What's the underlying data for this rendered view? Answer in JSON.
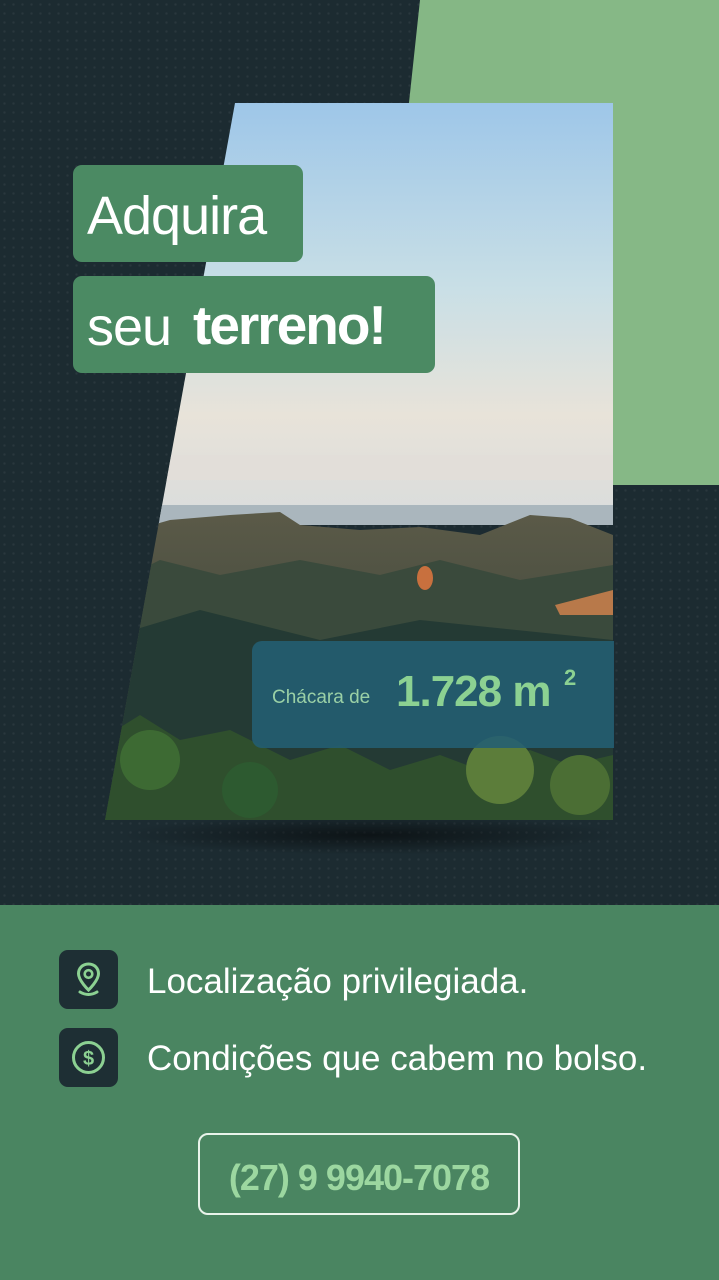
{
  "headline": {
    "line1": "Adquira",
    "line2_regular": "seu",
    "line2_bold": "terreno!"
  },
  "area": {
    "label": "Chácara de",
    "value": "1.728 m",
    "superscript": "2"
  },
  "features": [
    {
      "icon": "location-pin-icon",
      "text": "Localização privilegiada."
    },
    {
      "icon": "dollar-coin-icon",
      "text": "Condições que cabem no bolso."
    }
  ],
  "phone": "(27) 9 9940-7078",
  "colors": {
    "dark": "#1c2b31",
    "green": "#4a8561",
    "light_green": "#85b785",
    "accent_text": "#8cd192",
    "area_box": "#235f73"
  }
}
